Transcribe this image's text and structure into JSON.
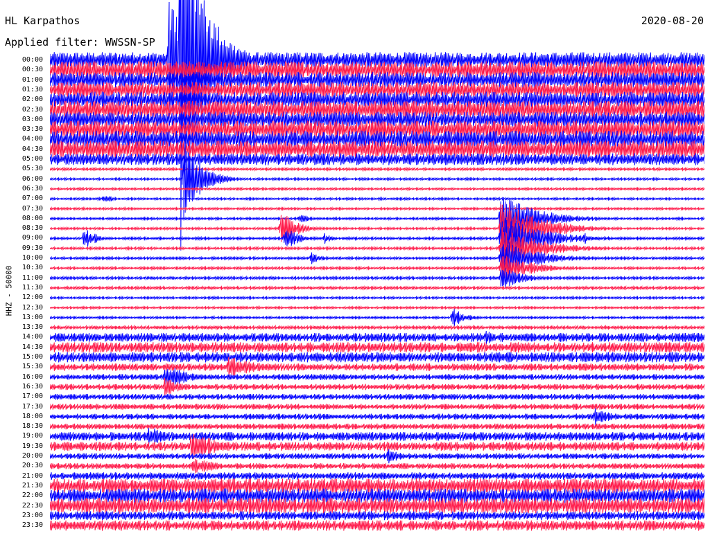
{
  "header": {
    "station": "HL Karpathos",
    "filter": "Applied filter: WWSSN-SP",
    "date": "2020-08-20"
  },
  "chart_data": {
    "type": "line",
    "title": "HL Karpathos",
    "date": "2020-08-20",
    "filter": "Applied filter: WWSSN-SP",
    "ylabel": "HHZ - 50000",
    "row_labels": [
      "00:00",
      "00:30",
      "01:00",
      "01:30",
      "02:00",
      "02:30",
      "03:00",
      "03:30",
      "04:00",
      "04:30",
      "05:00",
      "05:30",
      "06:00",
      "06:30",
      "07:00",
      "07:30",
      "08:00",
      "08:30",
      "09:00",
      "09:30",
      "10:00",
      "10:30",
      "11:00",
      "11:30",
      "12:00",
      "12:30",
      "13:00",
      "13:30",
      "14:00",
      "14:30",
      "15:00",
      "15:30",
      "16:00",
      "16:30",
      "17:00",
      "17:30",
      "18:00",
      "18:30",
      "19:00",
      "19:30",
      "20:00",
      "20:30",
      "21:00",
      "21:30",
      "22:00",
      "22:30",
      "23:00",
      "23:30"
    ],
    "trace_minutes_per_row": 30,
    "row_noise_level": [
      0.55,
      0.6,
      0.55,
      0.55,
      0.55,
      0.6,
      0.55,
      0.6,
      0.6,
      0.6,
      0.4,
      0.09,
      0.08,
      0.08,
      0.08,
      0.08,
      0.08,
      0.08,
      0.09,
      0.09,
      0.09,
      0.09,
      0.1,
      0.1,
      0.08,
      0.08,
      0.08,
      0.12,
      0.3,
      0.35,
      0.35,
      0.25,
      0.2,
      0.2,
      0.2,
      0.2,
      0.2,
      0.2,
      0.3,
      0.3,
      0.2,
      0.2,
      0.25,
      0.5,
      0.5,
      0.55,
      0.3,
      0.35
    ],
    "series_colors": [
      "#0000ff",
      "#ff1a4a"
    ],
    "events": [
      {
        "row": 0,
        "minute": 5.5,
        "amp": 8,
        "dur": 1.5
      },
      {
        "row": 0,
        "minute": 6.0,
        "amp": 20,
        "dur": 3.0
      },
      {
        "row": 12,
        "minute": 6.2,
        "amp": 3.5,
        "dur": 2.5
      },
      {
        "row": 12,
        "minute": 7.0,
        "amp": 0.7,
        "dur": 1.5
      },
      {
        "row": 14,
        "minute": 2.5,
        "amp": 0.6,
        "dur": 1.0
      },
      {
        "row": 16,
        "minute": 11.5,
        "amp": 0.6,
        "dur": 1.0
      },
      {
        "row": 18,
        "minute": 1.6,
        "amp": 1.2,
        "dur": 1.5
      },
      {
        "row": 17,
        "minute": 10.6,
        "amp": 2.0,
        "dur": 2.0
      },
      {
        "row": 18,
        "minute": 10.8,
        "amp": 1.2,
        "dur": 2.0
      },
      {
        "row": 18,
        "minute": 12.6,
        "amp": 0.6,
        "dur": 1.0
      },
      {
        "row": 20,
        "minute": 12.0,
        "amp": 0.6,
        "dur": 1.5
      },
      {
        "row": 26,
        "minute": 18.5,
        "amp": 1.2,
        "dur": 1.5
      },
      {
        "row": 16,
        "minute": 20.7,
        "amp": 2.5,
        "dur": 5.0
      },
      {
        "row": 17,
        "minute": 20.7,
        "amp": 3.2,
        "dur": 5.0
      },
      {
        "row": 18,
        "minute": 20.7,
        "amp": 2.8,
        "dur": 5.0
      },
      {
        "row": 19,
        "minute": 20.7,
        "amp": 2.4,
        "dur": 5.0
      },
      {
        "row": 20,
        "minute": 20.7,
        "amp": 2.0,
        "dur": 5.0
      },
      {
        "row": 21,
        "minute": 20.7,
        "amp": 1.6,
        "dur": 4.0
      },
      {
        "row": 22,
        "minute": 20.7,
        "amp": 1.2,
        "dur": 3.0
      },
      {
        "row": 18,
        "minute": 24.5,
        "amp": 0.6,
        "dur": 1.0
      },
      {
        "row": 28,
        "minute": 20.0,
        "amp": 0.7,
        "dur": 2.0
      },
      {
        "row": 31,
        "minute": 8.2,
        "amp": 1.2,
        "dur": 4.0
      },
      {
        "row": 32,
        "minute": 5.3,
        "amp": 1.4,
        "dur": 3.0
      },
      {
        "row": 33,
        "minute": 5.3,
        "amp": 1.2,
        "dur": 2.0
      },
      {
        "row": 36,
        "minute": 25.0,
        "amp": 1.0,
        "dur": 2.5
      },
      {
        "row": 38,
        "minute": 4.5,
        "amp": 1.2,
        "dur": 3.0
      },
      {
        "row": 39,
        "minute": 6.5,
        "amp": 1.5,
        "dur": 4.0
      },
      {
        "row": 40,
        "minute": 15.5,
        "amp": 0.8,
        "dur": 2.0
      },
      {
        "row": 41,
        "minute": 6.6,
        "amp": 1.0,
        "dur": 3.0
      },
      {
        "row": 44,
        "minute": 1.2,
        "amp": 0.8,
        "dur": 2.0
      }
    ],
    "legend": "none",
    "grid": false
  }
}
